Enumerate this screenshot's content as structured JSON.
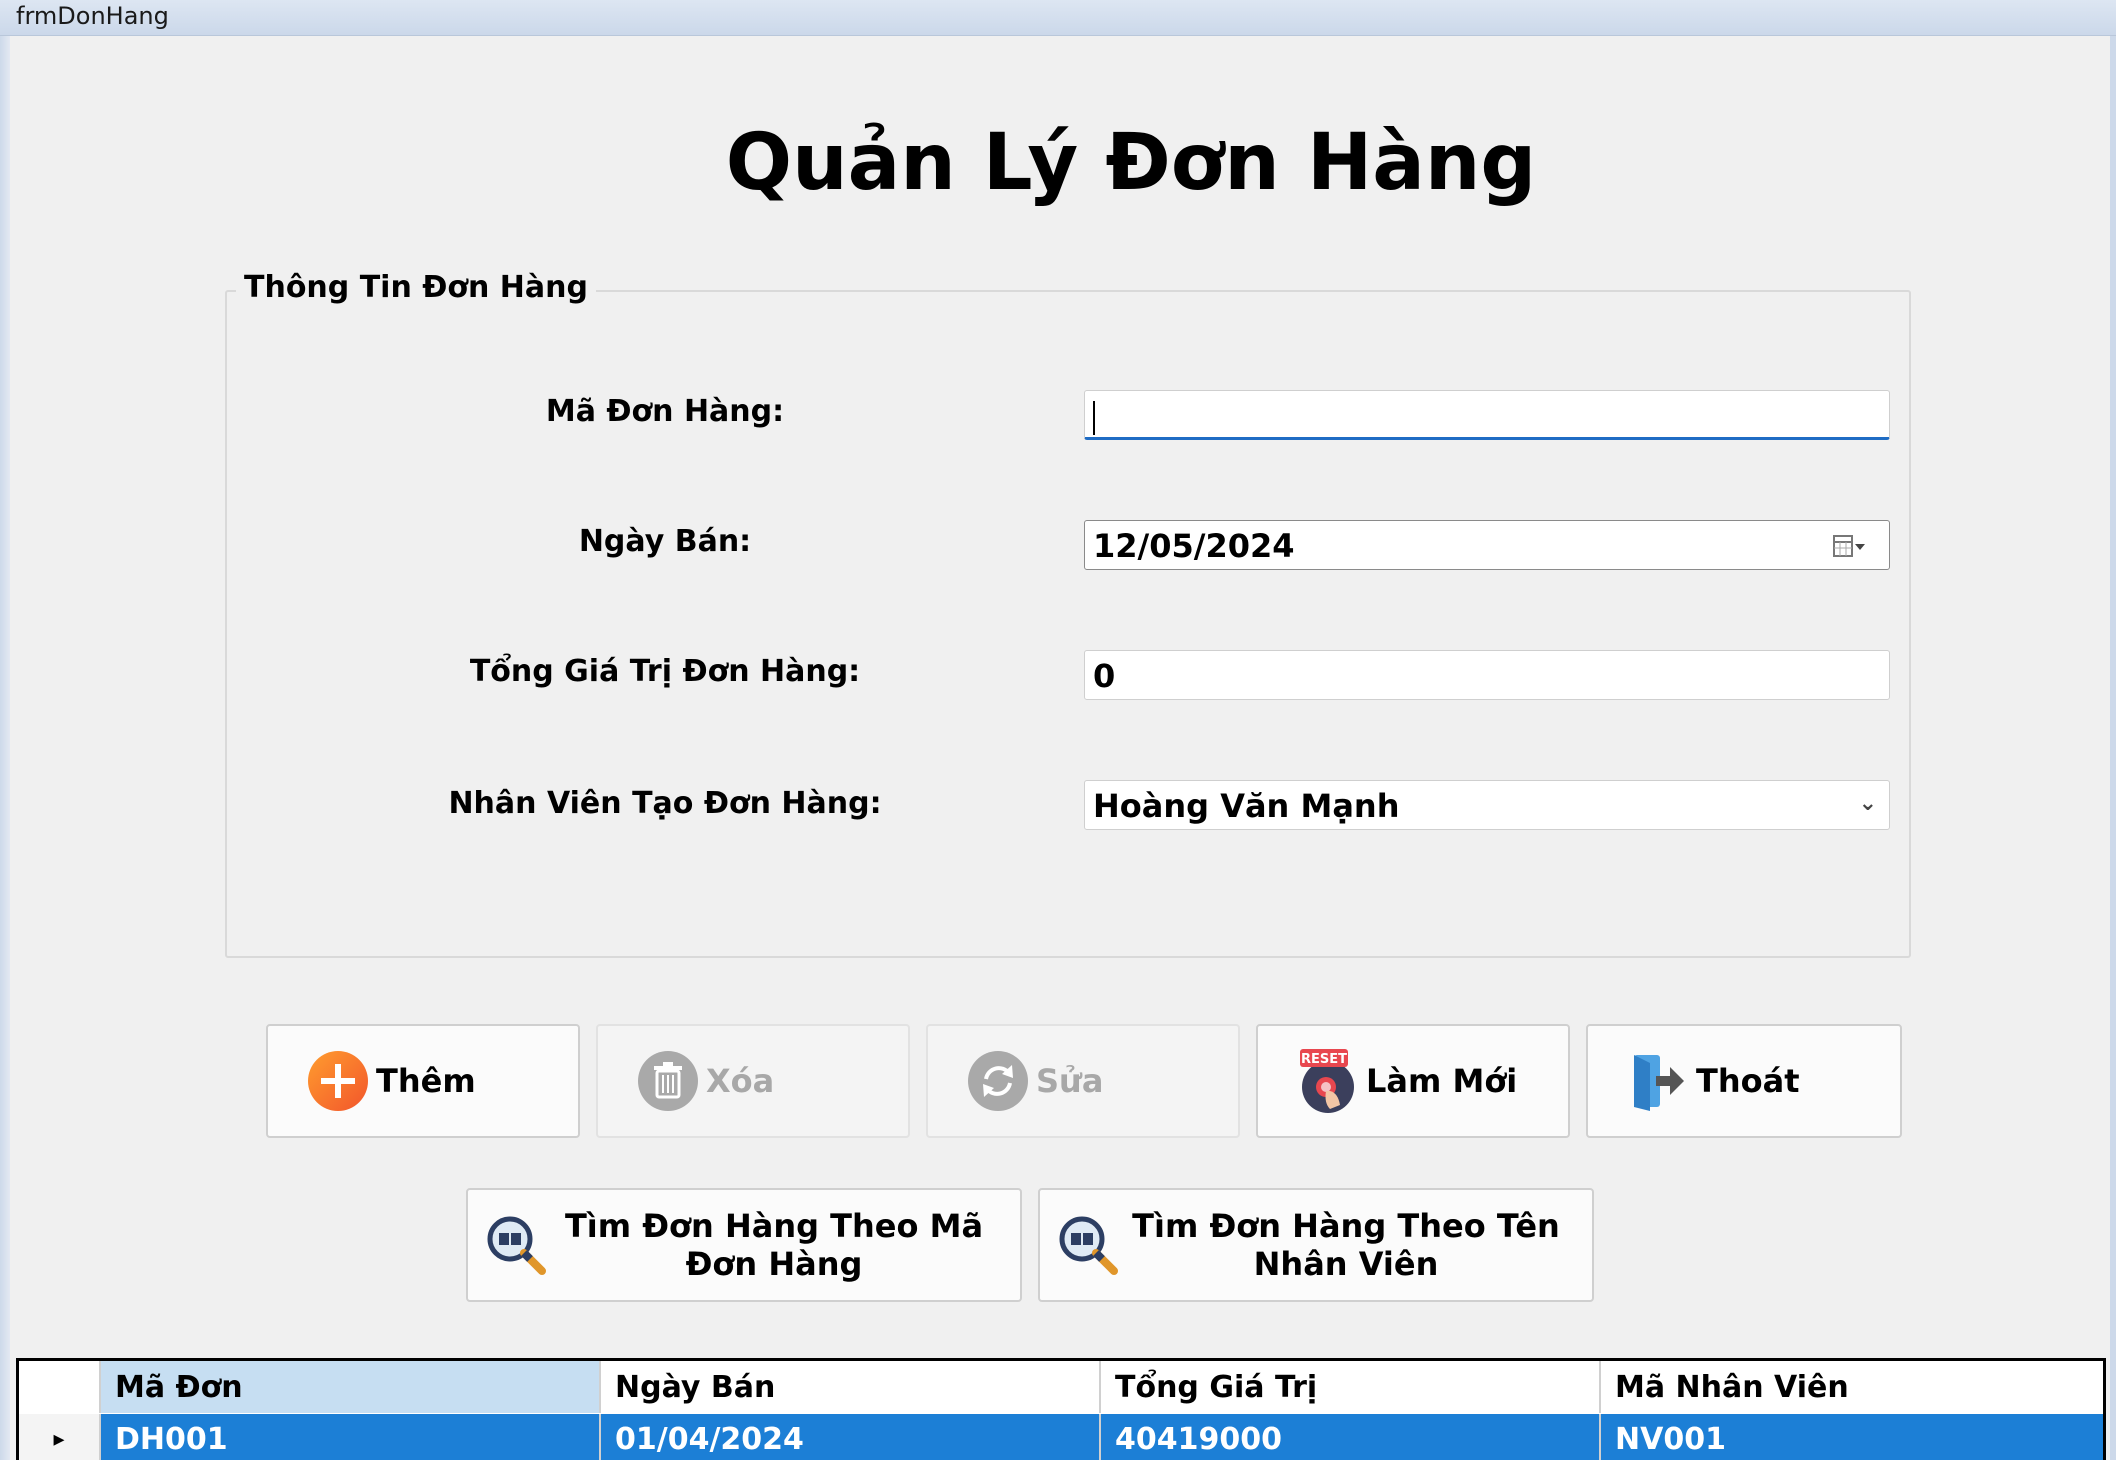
{
  "window": {
    "title": "frmDonHang"
  },
  "page": {
    "title": "Quản Lý Đơn Hàng"
  },
  "group": {
    "title": "Thông Tin Đơn Hàng",
    "fields": {
      "order_id": {
        "label": "Mã Đơn Hàng:",
        "value": ""
      },
      "sale_date": {
        "label": "Ngày Bán:",
        "value": "12/05/2024"
      },
      "total": {
        "label": "Tổng Giá Trị Đơn Hàng:",
        "value": "0"
      },
      "employee": {
        "label": "Nhân Viên Tạo Đơn Hàng:",
        "value": "Hoàng Văn Mạnh"
      }
    }
  },
  "buttons": {
    "add": {
      "label": "Thêm",
      "icon": "plus-circle-icon",
      "enabled": true
    },
    "delete": {
      "label": "Xóa",
      "icon": "trash-icon",
      "enabled": false
    },
    "edit": {
      "label": "Sửa",
      "icon": "refresh-icon",
      "enabled": false
    },
    "reset": {
      "label": "Làm Mới",
      "icon": "reset-icon",
      "badge": "RESET",
      "enabled": true
    },
    "exit": {
      "label": "Thoát",
      "icon": "exit-door-icon",
      "enabled": true
    },
    "search_by_id": {
      "label": "Tìm Đơn Hàng Theo Mã Đơn Hàng",
      "icon": "search-book-icon"
    },
    "search_by_employee": {
      "label": "Tìm Đơn Hàng Theo Tên Nhân Viên",
      "icon": "search-book-icon"
    }
  },
  "grid": {
    "columns": [
      "Mã Đơn",
      "Ngày Bán",
      "Tổng Giá Trị",
      "Mã Nhân Viên"
    ],
    "rows": [
      [
        "DH001",
        "01/04/2024",
        "40419000",
        "NV001"
      ]
    ],
    "selection_color": "#1c7fd6"
  }
}
